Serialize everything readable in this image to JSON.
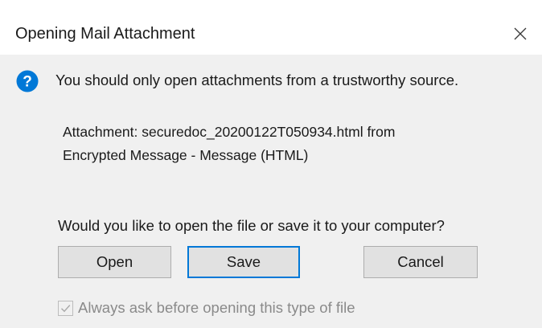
{
  "dialog": {
    "title": "Opening Mail Attachment",
    "close_icon": "close-icon",
    "info_icon": "question-mark-icon",
    "accent_color": "#0078d7",
    "warning_text": "You should only open attachments from a trustworthy source.",
    "attachment": {
      "line1": "Attachment: securedoc_20200122T050934.html from",
      "line2": "Encrypted Message - Message (HTML)"
    },
    "question_text": "Would you like to open the file or save it to your computer?",
    "buttons": {
      "open": "Open",
      "save": "Save",
      "cancel": "Cancel"
    },
    "always_ask": {
      "label": "Always ask before opening this type of file",
      "checked": true,
      "disabled": true
    }
  }
}
